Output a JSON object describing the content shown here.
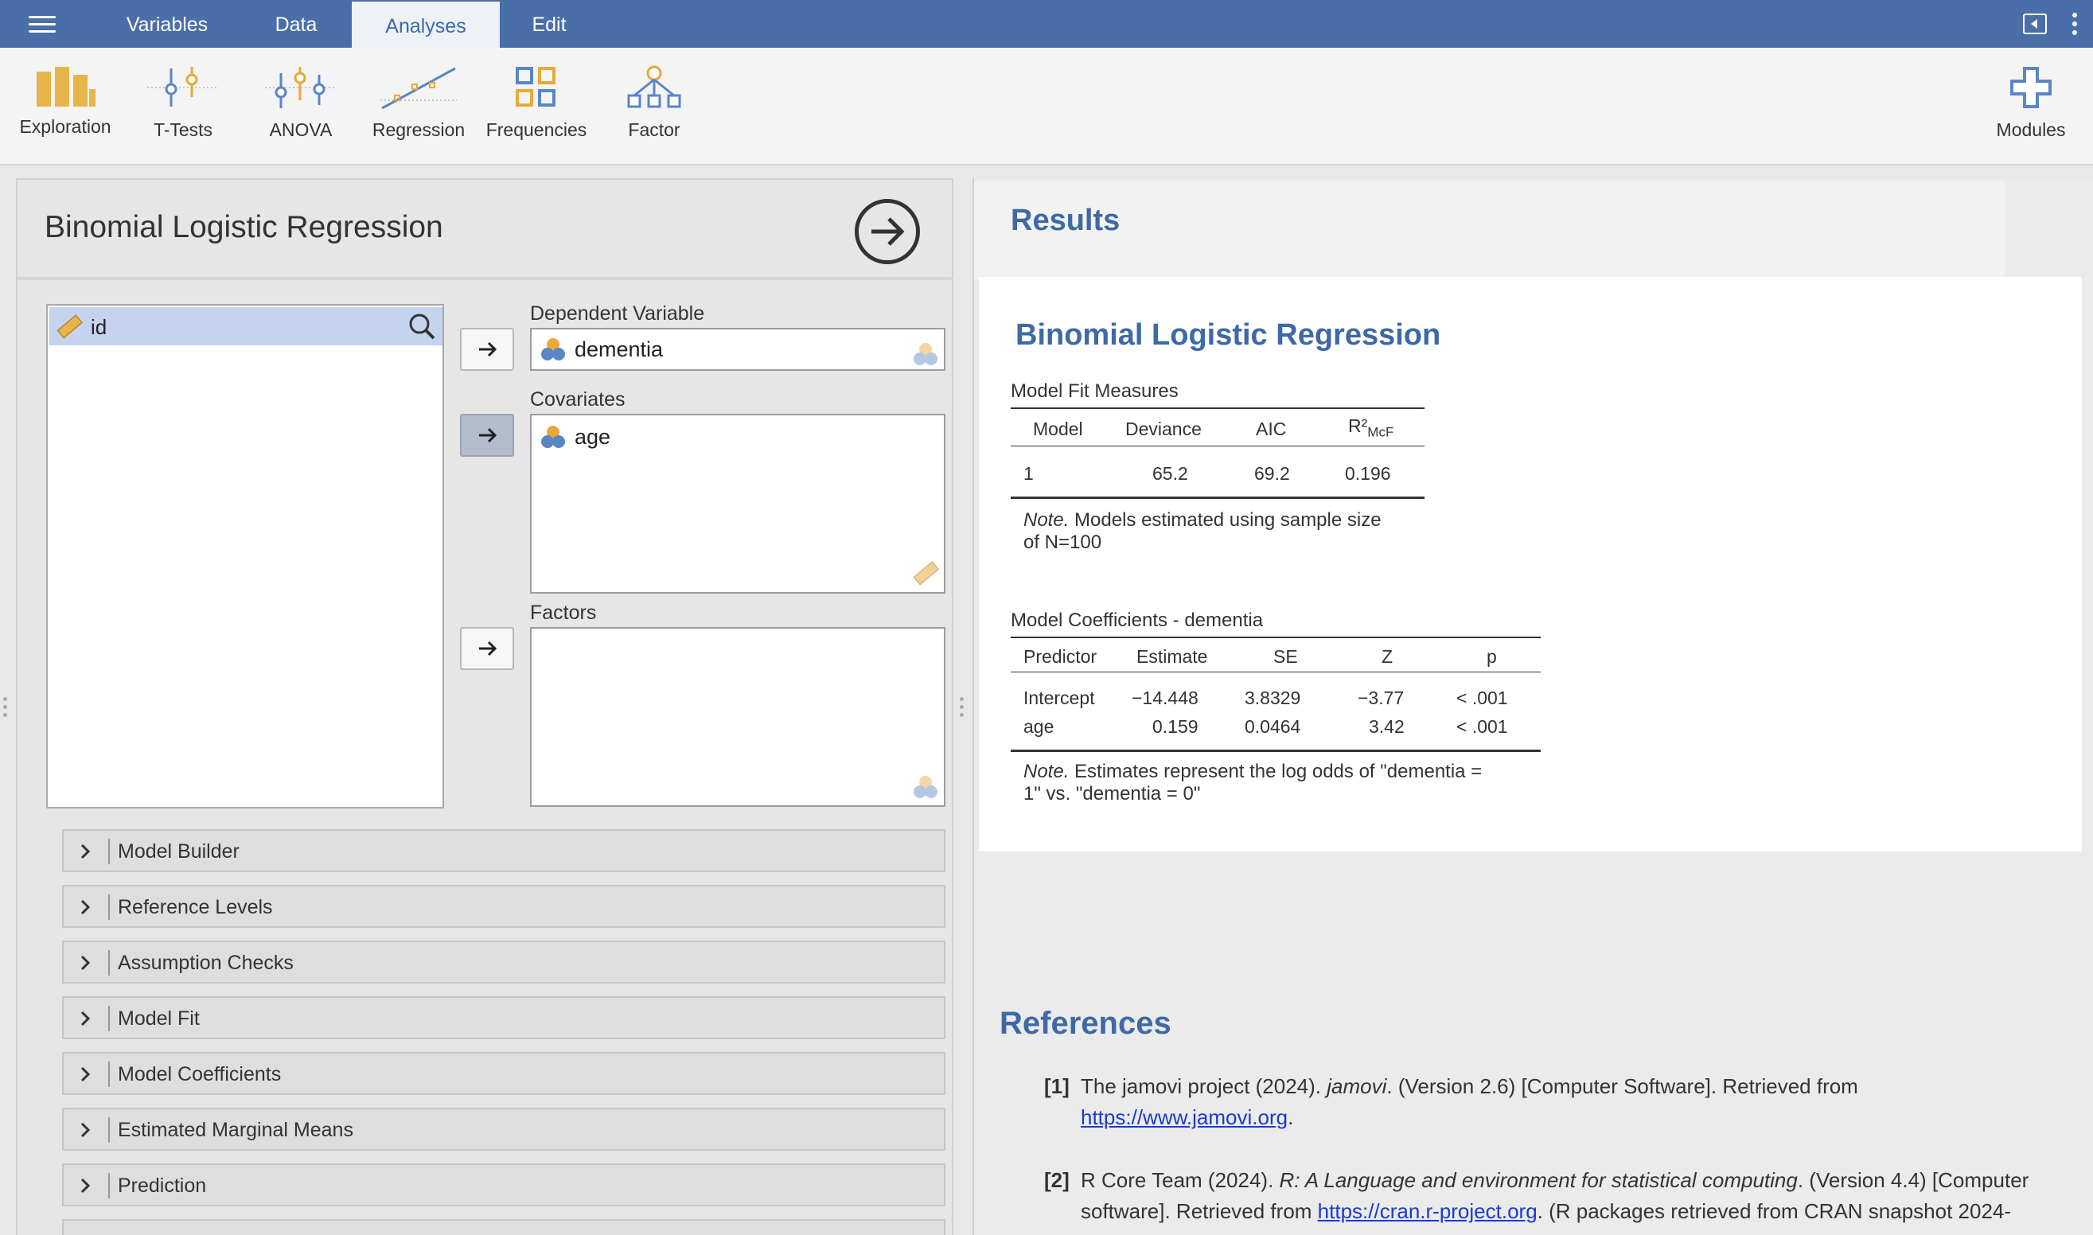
{
  "menu": {
    "icon": "hamburger-menu-icon"
  },
  "top_tabs": [
    {
      "label": "Variables",
      "active": false
    },
    {
      "label": "Data",
      "active": false
    },
    {
      "label": "Analyses",
      "active": true
    },
    {
      "label": "Edit",
      "active": false
    }
  ],
  "ribbon": {
    "buttons": [
      {
        "label": "Exploration",
        "icon": "exploration-bar-chart-icon"
      },
      {
        "label": "T-Tests",
        "icon": "t-tests-icon"
      },
      {
        "label": "ANOVA",
        "icon": "anova-icon"
      },
      {
        "label": "Regression",
        "icon": "regression-icon"
      },
      {
        "label": "Frequencies",
        "icon": "frequencies-icon"
      },
      {
        "label": "Factor",
        "icon": "factor-icon"
      }
    ],
    "modules": {
      "label": "Modules",
      "icon": "plus-icon"
    }
  },
  "colors": {
    "topbar": "#4a6ea7",
    "accent": "#3e69a5",
    "selection": "#c4d3ee",
    "link": "#1a3ad0"
  },
  "options": {
    "title": "Binomial Logistic Regression",
    "variables": [
      {
        "name": "id",
        "icon": "continuous-ruler-icon",
        "selected": true
      }
    ],
    "dependent": {
      "label": "Dependent Variable",
      "value": "dementia",
      "icon": "nominal-variable-icon"
    },
    "covariates": {
      "label": "Covariates",
      "items": [
        "age"
      ],
      "icon": "nominal-variable-icon"
    },
    "factors": {
      "label": "Factors",
      "items": []
    },
    "sections": [
      "Model Builder",
      "Reference Levels",
      "Assumption Checks",
      "Model Fit",
      "Model Coefficients",
      "Estimated Marginal Means",
      "Prediction"
    ]
  },
  "results": {
    "heading": "Results",
    "analysis_title": "Binomial Logistic Regression",
    "fit": {
      "title": "Model Fit Measures",
      "headers": [
        "Model",
        "Deviance",
        "AIC",
        "R²",
        "McF"
      ],
      "row": [
        "1",
        "65.2",
        "69.2",
        "0.196"
      ],
      "note_label": "Note.",
      "note_line1": "Models estimated using sample size",
      "note_line2": "of N=100"
    },
    "coef": {
      "title": "Model Coefficients - dementia",
      "headers": [
        "Predictor",
        "Estimate",
        "SE",
        "Z",
        "p"
      ],
      "rows": [
        [
          "Intercept",
          "−14.448",
          "3.8329",
          "−3.77",
          "< .001"
        ],
        [
          "age",
          "0.159",
          "0.0464",
          "3.42",
          "< .001"
        ]
      ],
      "note_label": "Note.",
      "note_line1": "Estimates represent the log odds of \"dementia =",
      "note_line2": "1\" vs. \"dementia = 0\""
    }
  },
  "references": {
    "title": "References",
    "items": [
      {
        "num": "[1]",
        "pre": "The jamovi project (2024). ",
        "ital": "jamovi",
        "post": ". (Version 2.6) [Computer Software]. Retrieved from",
        "link": "https://www.jamovi.org",
        "tail": "."
      },
      {
        "num": "[2]",
        "pre": "R Core Team (2024). ",
        "ital": "R: A Language and environment for statistical computing",
        "post": ". (Version 4.4) [Computer software]. Retrieved from ",
        "link": "https://cran.r-project.org",
        "tail": ". (R packages retrieved from CRAN snapshot 2024-"
      }
    ]
  }
}
